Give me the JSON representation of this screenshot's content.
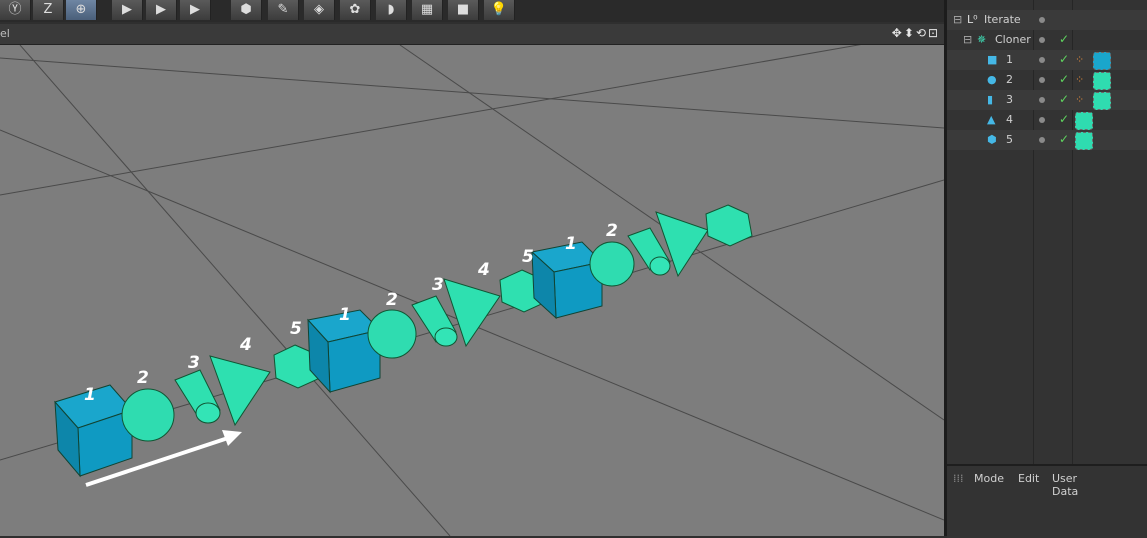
{
  "viewport": {
    "menu_fragment": "el",
    "nav_icons": "✥⬍⟲⊡",
    "clone_labels": [
      "1",
      "2",
      "3",
      "4",
      "5",
      "1",
      "2",
      "3",
      "4",
      "5",
      "1",
      "2"
    ]
  },
  "object_manager": {
    "rows": [
      {
        "name": "Iterate",
        "icon": "null-object-icon"
      },
      {
        "name": "Cloner",
        "icon": "cloner-icon"
      },
      {
        "name": "1",
        "icon": "cube-icon"
      },
      {
        "name": "2",
        "icon": "sphere-icon"
      },
      {
        "name": "3",
        "icon": "cylinder-icon"
      },
      {
        "name": "4",
        "icon": "cone-icon"
      },
      {
        "name": "5",
        "icon": "icosahedron-icon"
      }
    ]
  },
  "attribute_manager": {
    "tabs": [
      "Mode",
      "Edit",
      "User Data"
    ]
  },
  "colors": {
    "cube": "#0f9ac2",
    "shape": "#2fe0b0",
    "grid_bg": "#7d7d7d"
  }
}
